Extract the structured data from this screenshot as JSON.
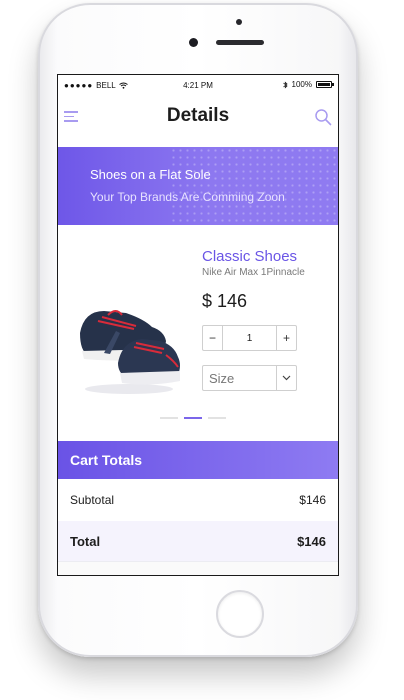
{
  "status_bar": {
    "carrier": "BELL",
    "time": "4:21 PM",
    "battery": "100%",
    "battery_level": 1.0
  },
  "header": {
    "title": "Details",
    "menu_icon": "hamburger-menu-icon",
    "search_icon": "search-icon"
  },
  "banner": {
    "title": "Shoes on a Flat Sole",
    "subtitle": "Your Top Brands Are Comming Zoon"
  },
  "product": {
    "name": "Classic Shoes",
    "model": "Nike Air Max 1Pinnacle",
    "price": "$ 146",
    "quantity": "1",
    "minus_label": "−",
    "plus_label": "+",
    "size_placeholder": "Size",
    "carousel_pages": 3,
    "carousel_active": 2
  },
  "cart": {
    "title": "Cart Totals",
    "subtotal_label": "Subtotal",
    "subtotal_value": "$146",
    "total_label": "Total",
    "total_value": "$146"
  },
  "colors": {
    "accent": "#6a55e6",
    "banner_start": "#6e57e8",
    "banner_end": "#8f7bf1",
    "total_row_bg": "#f5f3fd"
  }
}
